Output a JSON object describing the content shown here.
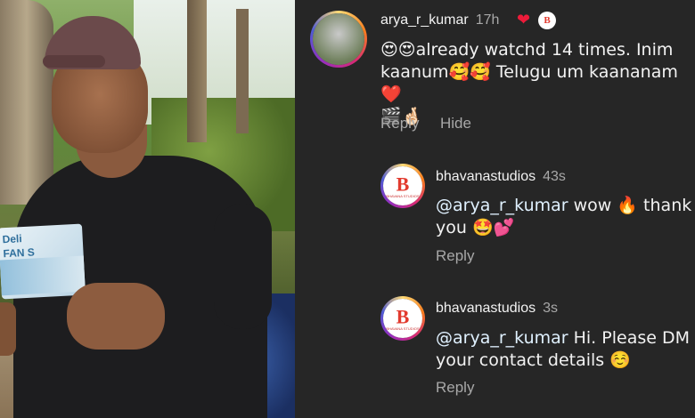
{
  "comment_main": {
    "username": "arya_r_kumar",
    "time": "17h",
    "text_line1": "😍😍already watchd 14 times. Inim",
    "text_line2": "kaanum🥰🥰 Telugu um kaananam❤️",
    "text_line3": "🎬🤞🏻",
    "reply_label": "Reply",
    "hide_label": "Hide"
  },
  "reply1": {
    "username": "bhavanastudios",
    "time": "43s",
    "mention": "@arya_r_kumar",
    "text_line1_rest": " wow 🔥 thank",
    "text_line2": "you 🤩💕",
    "reply_label": "Reply"
  },
  "reply2": {
    "username": "bhavanastudios",
    "time": "3s",
    "mention": "@arya_r_kumar",
    "text_line1_rest": " Hi. Please DM",
    "text_line2": "your contact details ☺️",
    "reply_label": "Reply"
  },
  "brand": {
    "logo_letter": "B",
    "logo_text": "BHAVANA STUDIOS"
  },
  "photo": {
    "card_title": "Deli",
    "card_subtitle": "FAN S"
  },
  "colors": {
    "panel_bg": "#262626",
    "heart": "#ed1b3a",
    "muted": "#a8a8a8"
  }
}
